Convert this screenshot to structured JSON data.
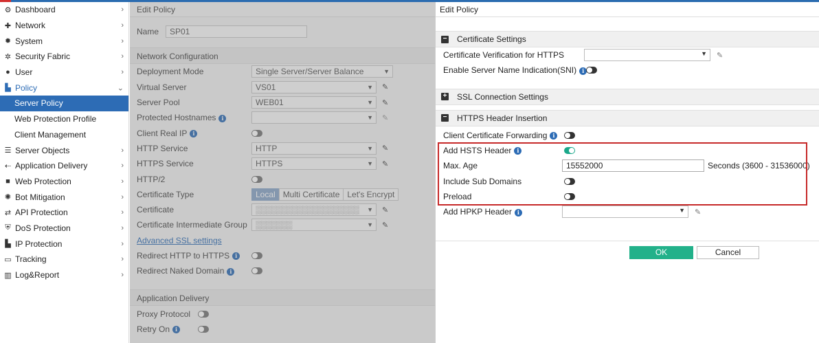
{
  "sidebar": {
    "items": [
      {
        "label": "Dashboard",
        "icon": "dashboard-icon",
        "glyph": "⚙"
      },
      {
        "label": "Network",
        "icon": "network-icon",
        "glyph": "✚"
      },
      {
        "label": "System",
        "icon": "system-gear-icon",
        "glyph": "✹"
      },
      {
        "label": "Security Fabric",
        "icon": "security-fabric-icon",
        "glyph": "✲"
      },
      {
        "label": "User",
        "icon": "user-icon",
        "glyph": "👤"
      },
      {
        "label": "Policy",
        "icon": "policy-icon",
        "glyph": "▙"
      }
    ],
    "policy_sub": [
      "Server Policy",
      "Web Protection Profile",
      "Client Management"
    ],
    "items_after": [
      {
        "label": "Server Objects",
        "icon": "server-objects-icon",
        "glyph": "☰"
      },
      {
        "label": "Application Delivery",
        "icon": "application-delivery-icon",
        "glyph": "⇠"
      },
      {
        "label": "Web Protection",
        "icon": "lock-icon",
        "glyph": "🔒"
      },
      {
        "label": "Bot Mitigation",
        "icon": "bot-icon",
        "glyph": "✺"
      },
      {
        "label": "API Protection",
        "icon": "api-arrows-icon",
        "glyph": "⇄"
      },
      {
        "label": "DoS Protection",
        "icon": "shield-icon",
        "glyph": "⛨"
      },
      {
        "label": "IP Protection",
        "icon": "ip-protection-icon",
        "glyph": "▙"
      },
      {
        "label": "Tracking",
        "icon": "tracking-monitor-icon",
        "glyph": "▭"
      },
      {
        "label": "Log&Report",
        "icon": "log-report-icon",
        "glyph": "▥"
      }
    ]
  },
  "bg": {
    "title": "Edit Policy",
    "name_label": "Name",
    "name_value": "SP01",
    "network_section": "Network Configuration",
    "deployment_mode_label": "Deployment Mode",
    "deployment_mode_value": "Single Server/Server Balance",
    "virtual_server_label": "Virtual Server",
    "virtual_server_value": "VS01",
    "server_pool_label": "Server Pool",
    "server_pool_value": "WEB01",
    "protected_hostnames_label": "Protected Hostnames",
    "client_real_ip_label": "Client Real IP",
    "http_service_label": "HTTP Service",
    "http_service_value": "HTTP",
    "https_service_label": "HTTPS Service",
    "https_service_value": "HTTPS",
    "http2_label": "HTTP/2",
    "cert_type_label": "Certificate Type",
    "cert_type_options": [
      "Local",
      "Multi Certificate",
      "Let's Encrypt"
    ],
    "certificate_label": "Certificate",
    "cert_intermediate_label": "Certificate Intermediate Group",
    "advanced_ssl_link": "Advanced SSL settings",
    "redirect_http_label": "Redirect HTTP to HTTPS",
    "redirect_naked_label": "Redirect Naked Domain",
    "app_delivery_section": "Application Delivery",
    "proxy_protocol_label": "Proxy Protocol",
    "retry_on_label": "Retry On"
  },
  "dialog": {
    "title": "Edit Policy",
    "cert_settings_section": "Certificate Settings",
    "cert_verification_label": "Certificate Verification for HTTPS",
    "cert_verification_value": "",
    "sni_label": "Enable Server Name Indication(SNI)",
    "sni_enabled": false,
    "ssl_section": "SSL Connection Settings",
    "https_header_section": "HTTPS Header Insertion",
    "client_cert_fwd_label": "Client Certificate Forwarding",
    "client_cert_fwd_enabled": false,
    "hsts_label": "Add HSTS Header",
    "hsts_enabled": true,
    "max_age_label": "Max. Age",
    "max_age_value": "15552000",
    "max_age_hint": "Seconds (3600 - 31536000)",
    "subdomains_label": "Include Sub Domains",
    "subdomains_enabled": false,
    "preload_label": "Preload",
    "preload_enabled": false,
    "hpkp_label": "Add HPKP Header",
    "hpkp_value": "",
    "ok_label": "OK",
    "cancel_label": "Cancel"
  },
  "colors": {
    "accent": "#2d6cb5",
    "ok_button": "#22b18a",
    "toggle_on": "#1aa88a",
    "highlight_box": "#c62828"
  }
}
